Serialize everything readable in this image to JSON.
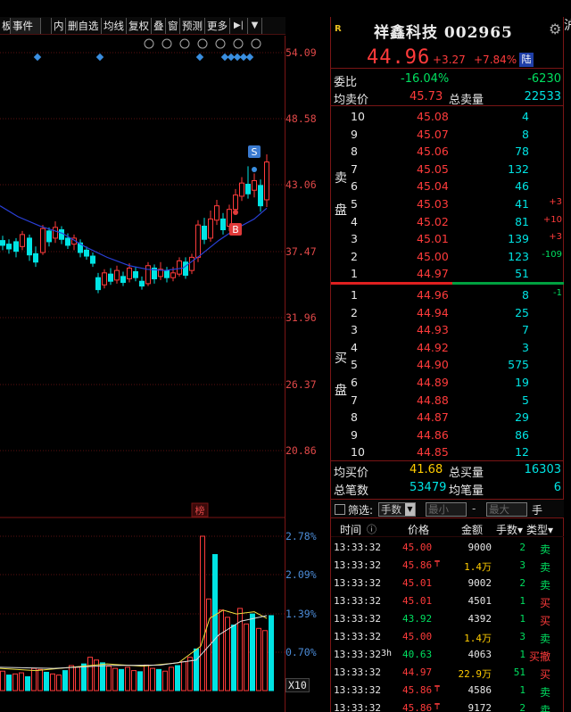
{
  "toolbar": {
    "tabs": [
      "板",
      "事件",
      "",
      "内",
      "删自选",
      "均线",
      "复权",
      "叠",
      "窗",
      "预测",
      "更多"
    ],
    "more_arrow": "▼",
    "forward_icon": "▶|"
  },
  "chart_icons": [
    "settings-icon",
    "pen-icon",
    "eye-icon",
    "store-icon",
    "hand-icon",
    "zoom-in-icon",
    "zoom-out-icon"
  ],
  "price_axis": [
    "54.09",
    "48.58",
    "43.06",
    "37.47",
    "31.96",
    "26.37",
    "20.86"
  ],
  "volume_axis": [
    "2.78%",
    "2.09%",
    "1.39%",
    "0.70%",
    "X10"
  ],
  "markers": {
    "sell": "S",
    "buy": "B",
    "bang": "榜"
  },
  "stock": {
    "name_code": "祥鑫科技 002965",
    "r_mark": "R",
    "price": "44.96",
    "change": "+3.27",
    "change_pct": "+7.84%",
    "exchange": "陆"
  },
  "stats_top": {
    "weibi_label": "委比",
    "weibi_pct": "-16.04%",
    "weibi_val": "-6230",
    "avg_ask_label": "均卖价",
    "avg_ask": "45.73",
    "total_ask_label": "总卖量",
    "total_ask": "22533"
  },
  "sell_label": [
    "卖",
    "盘"
  ],
  "buy_label": [
    "买",
    "盘"
  ],
  "asks": [
    {
      "lvl": "10",
      "price": "45.08",
      "vol": "4",
      "chg": ""
    },
    {
      "lvl": "9",
      "price": "45.07",
      "vol": "8",
      "chg": ""
    },
    {
      "lvl": "8",
      "price": "45.06",
      "vol": "78",
      "chg": ""
    },
    {
      "lvl": "7",
      "price": "45.05",
      "vol": "132",
      "chg": ""
    },
    {
      "lvl": "6",
      "price": "45.04",
      "vol": "46",
      "chg": ""
    },
    {
      "lvl": "5",
      "price": "45.03",
      "vol": "41",
      "chg": "+3"
    },
    {
      "lvl": "4",
      "price": "45.02",
      "vol": "81",
      "chg": "+10"
    },
    {
      "lvl": "3",
      "price": "45.01",
      "vol": "139",
      "chg": "+3"
    },
    {
      "lvl": "2",
      "price": "45.00",
      "vol": "123",
      "chg": "-109"
    },
    {
      "lvl": "1",
      "price": "44.97",
      "vol": "51",
      "chg": ""
    }
  ],
  "bids": [
    {
      "lvl": "1",
      "price": "44.96",
      "vol": "8",
      "chg": "-1"
    },
    {
      "lvl": "2",
      "price": "44.94",
      "vol": "25",
      "chg": ""
    },
    {
      "lvl": "3",
      "price": "44.93",
      "vol": "7",
      "chg": ""
    },
    {
      "lvl": "4",
      "price": "44.92",
      "vol": "3",
      "chg": ""
    },
    {
      "lvl": "5",
      "price": "44.90",
      "vol": "575",
      "chg": ""
    },
    {
      "lvl": "6",
      "price": "44.89",
      "vol": "19",
      "chg": ""
    },
    {
      "lvl": "7",
      "price": "44.88",
      "vol": "5",
      "chg": ""
    },
    {
      "lvl": "8",
      "price": "44.87",
      "vol": "29",
      "chg": ""
    },
    {
      "lvl": "9",
      "price": "44.86",
      "vol": "86",
      "chg": ""
    },
    {
      "lvl": "10",
      "price": "44.85",
      "vol": "12",
      "chg": ""
    }
  ],
  "stats_bottom": {
    "avg_bid_label": "均买价",
    "avg_bid": "41.68",
    "total_bid_label": "总买量",
    "total_bid": "16303",
    "deals_label": "总笔数",
    "deals": "53479",
    "avg_lot_label": "均笔量",
    "avg_lot": "6"
  },
  "filter": {
    "label": "筛选:",
    "unit_select": "手数",
    "min_ph": "最小",
    "dash": "-",
    "max_ph": "最大",
    "unit": "手"
  },
  "ticks_header": [
    "时间",
    "ⓘ",
    "价格",
    "金额",
    "手数▾",
    "类型▾"
  ],
  "ticks": [
    {
      "time": "13:33:32",
      "flag": "",
      "price": "45.00",
      "pmark": "",
      "amount": "9000",
      "lots": "2",
      "type": "卖"
    },
    {
      "time": "13:33:32",
      "flag": "",
      "price": "45.86",
      "pmark": "₸",
      "amount": "1.4万",
      "lots": "3",
      "type": "卖"
    },
    {
      "time": "13:33:32",
      "flag": "",
      "price": "45.01",
      "pmark": "",
      "amount": "9002",
      "lots": "2",
      "type": "卖"
    },
    {
      "time": "13:33:32",
      "flag": "",
      "price": "45.01",
      "pmark": "",
      "amount": "4501",
      "lots": "1",
      "type": "买"
    },
    {
      "time": "13:33:32",
      "flag": "",
      "price": "43.92",
      "pmark": "",
      "amount": "4392",
      "lots": "1",
      "type": "买"
    },
    {
      "time": "13:33:32",
      "flag": "",
      "price": "45.00",
      "pmark": "",
      "amount": "1.4万",
      "lots": "3",
      "type": "卖"
    },
    {
      "time": "13:33:32",
      "flag": "3h",
      "price": "40.63",
      "pmark": "",
      "amount": "4063",
      "lots": "1",
      "type": "买撤"
    },
    {
      "time": "13:33:32",
      "flag": "",
      "price": "44.97",
      "pmark": "",
      "amount": "22.9万",
      "lots": "51",
      "type": "买"
    },
    {
      "time": "13:33:32",
      "flag": "",
      "price": "45.86",
      "pmark": "₸",
      "amount": "4586",
      "lots": "1",
      "type": "卖"
    },
    {
      "time": "13:33:32",
      "flag": "",
      "price": "45.86",
      "pmark": "₸",
      "amount": "9172",
      "lots": "2",
      "type": "卖"
    }
  ],
  "right_strip": [
    "沪",
    "",
    "",
    "",
    "",
    "",
    "",
    "",
    "",
    "",
    "",
    "",
    "",
    "",
    "",
    "",
    "",
    "",
    "",
    "",
    "",
    "",
    "",
    "",
    "",
    "",
    "",
    "",
    "",
    "",
    "",
    "",
    "",
    "",
    "",
    "",
    "",
    "",
    ""
  ],
  "colors": {
    "up": "#ff3b3b",
    "down": "#00e4e4",
    "ma": "#2a40d8",
    "grid": "#7a1515",
    "text": "#e8e8e8"
  }
}
